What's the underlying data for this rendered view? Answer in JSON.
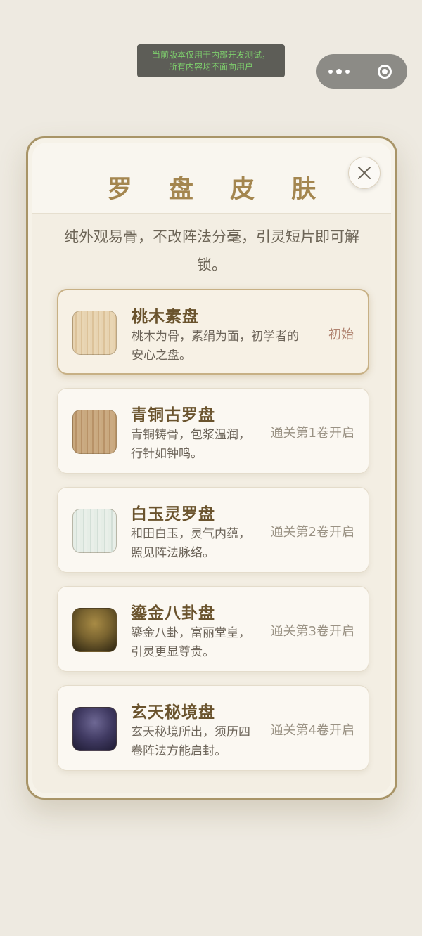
{
  "dev_banner": {
    "line1": "当前版本仅用于内部开发测试，",
    "line2": "所有内容均不面向用户"
  },
  "capsule": {
    "more_icon": "more-dots-icon",
    "close_icon": "target-ring-icon"
  },
  "modal": {
    "title": "罗 盘 皮 肤",
    "subtitle": "纯外观易骨，不改阵法分毫，引灵短片即可解锁。",
    "close_icon": "close-x-icon"
  },
  "skins": [
    {
      "name": "桃木素盘",
      "desc": "桃木为骨，素绢为面，初学者的安心之盘。",
      "status": "初始",
      "swatch": "peach-wood"
    },
    {
      "name": "青铜古罗盘",
      "desc": "青铜铸骨，包浆温润，行针如钟鸣。",
      "status": "通关第1卷开启",
      "swatch": "bronze"
    },
    {
      "name": "白玉灵罗盘",
      "desc": "和田白玉，灵气内蕴，照见阵法脉络。",
      "status": "通关第2卷开启",
      "swatch": "jade"
    },
    {
      "name": "鎏金八卦盘",
      "desc": "鎏金八卦，富丽堂皇，引灵更显尊贵。",
      "status": "通关第3卷开启",
      "swatch": "gold"
    },
    {
      "name": "玄天秘境盘",
      "desc": "玄天秘境所出，须历四卷阵法方能启封。",
      "status": "通关第4卷开启",
      "swatch": "xuantian"
    }
  ],
  "colors": {
    "accent_gold": "#a4864f",
    "border_gold": "#a89467",
    "initial_status": "#b08370",
    "background": "#eeeae1"
  }
}
